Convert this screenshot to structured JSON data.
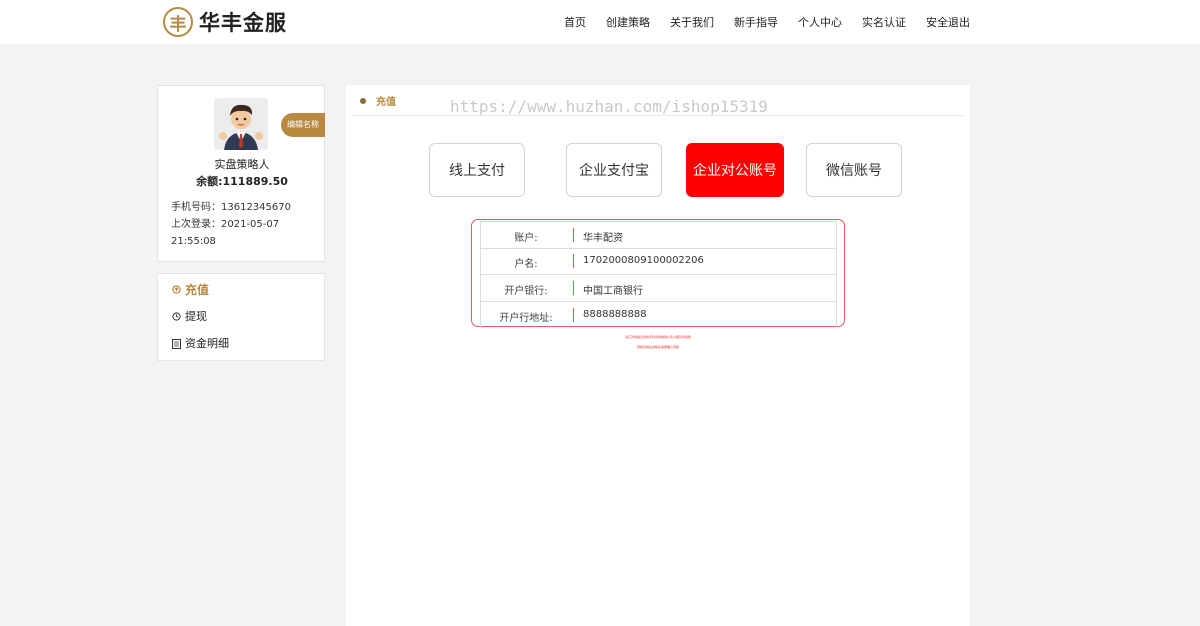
{
  "header": {
    "logo_glyph": "丰",
    "logo_text": "华丰金服",
    "nav": [
      "首页",
      "创建策略",
      "关于我们",
      "新手指导",
      "个人中心",
      "实名认证",
      "安全退出"
    ]
  },
  "profile": {
    "edit_label": "编辑名称",
    "name": "实盘策略人",
    "balance": "余额:111889.50",
    "phone": "手机号码：13612345670",
    "last_login": "上次登录：2021-05-07",
    "last_login_time": "21:55:08"
  },
  "menu": {
    "items": [
      {
        "label": "充值",
        "icon": "recharge-icon"
      },
      {
        "label": "提现",
        "icon": "withdraw-icon"
      },
      {
        "label": "资金明细",
        "icon": "ledger-icon"
      }
    ]
  },
  "panel": {
    "title": "充值",
    "watermark": "https://www.huzhan.com/ishop15319",
    "pay_methods": [
      "线上支付",
      "企业支付宝",
      "企业对公账号",
      "微信账号"
    ],
    "active_method": "企业对公账号",
    "account": {
      "rows": [
        {
          "label": "账户:",
          "value": "华丰配资"
        },
        {
          "label": "户名:",
          "value": "1702000809100002206"
        },
        {
          "label": "开户银行:",
          "value": "中国工商银行"
        },
        {
          "label": "开户行地址:",
          "value": "8888888888"
        }
      ]
    },
    "notes": [
      "请汇款时备注您的手机号码或用户名以便及时到账",
      "转账完成后请联系客服确认到账"
    ]
  },
  "colors": {
    "accent": "#b8893e",
    "active": "#ff0000",
    "box_border": "#e05a5a"
  }
}
